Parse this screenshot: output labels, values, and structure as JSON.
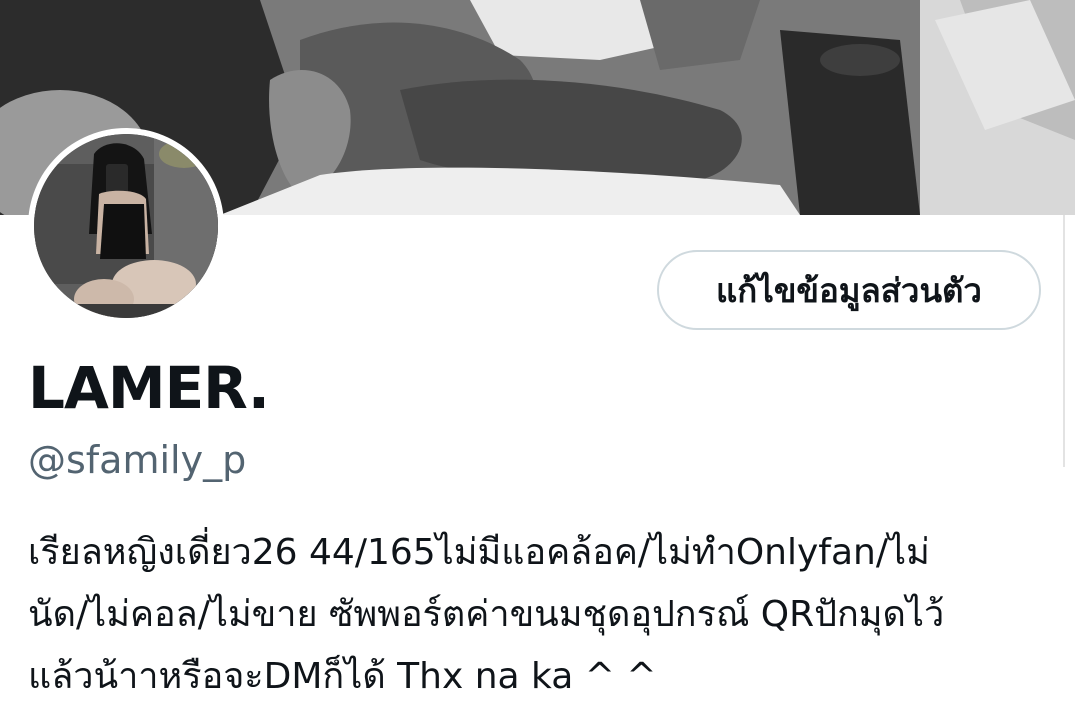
{
  "profile": {
    "display_name": "LAMER.",
    "handle": "@sfamily_p",
    "edit_button_label": "แก้ไขข้อมูลส่วนตัว",
    "bio_lines": [
      "เรียลหญิงเดี่ยว26 44/165ไม่มีแอคล้อค/ไม่ทำOnlyfan/ไม่",
      "นัด/ไม่คอล/ไม่ขาย  ซัพพอร์ตค่าขนมชุดอุปกรณ์ QRปักมุดไว้",
      "แล้วน้าาหรือจะDMก็ได้ Thx na ka ^ ^"
    ]
  },
  "colors": {
    "text_primary": "#0f1419",
    "text_secondary": "#536471",
    "button_border": "#cfd9de",
    "background": "#ffffff"
  }
}
